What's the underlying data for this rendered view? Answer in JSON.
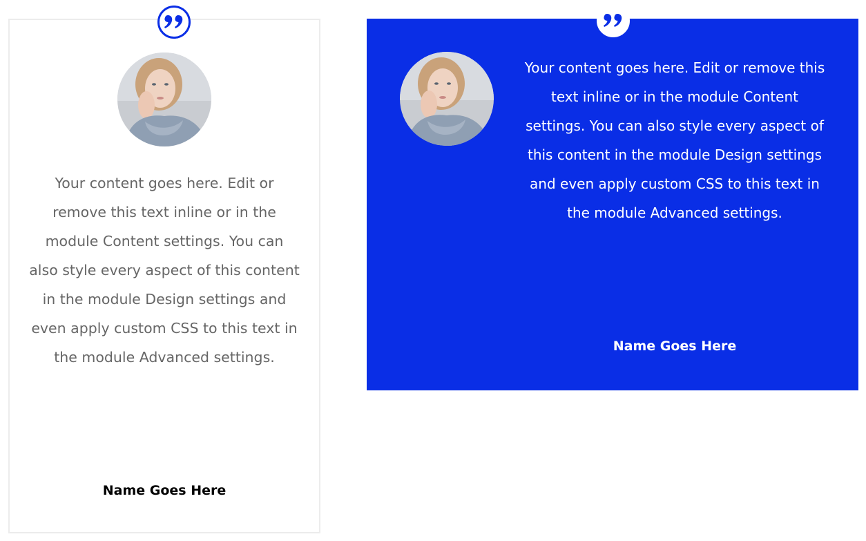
{
  "colors": {
    "accent_blue": "#0a2ee6",
    "card_border": "#ececec",
    "body_text_gray": "#666666"
  },
  "testimonials": [
    {
      "style": "light",
      "icon": "quote-icon",
      "avatar": "woman-portrait-avatar",
      "content": "Your content goes here. Edit or remove this text inline or in the module Content settings. You can also style every aspect of this content in the module Design settings and even apply custom CSS to this text in the module Advanced settings.",
      "author": "Name Goes Here"
    },
    {
      "style": "blue",
      "icon": "quote-icon",
      "avatar": "woman-portrait-avatar",
      "content": "Your content goes here. Edit or remove this text inline or in the module Content settings. You can also style every aspect of this content in the module Design settings and even apply custom CSS to this text in the module Advanced settings.",
      "author": "Name Goes Here"
    }
  ]
}
